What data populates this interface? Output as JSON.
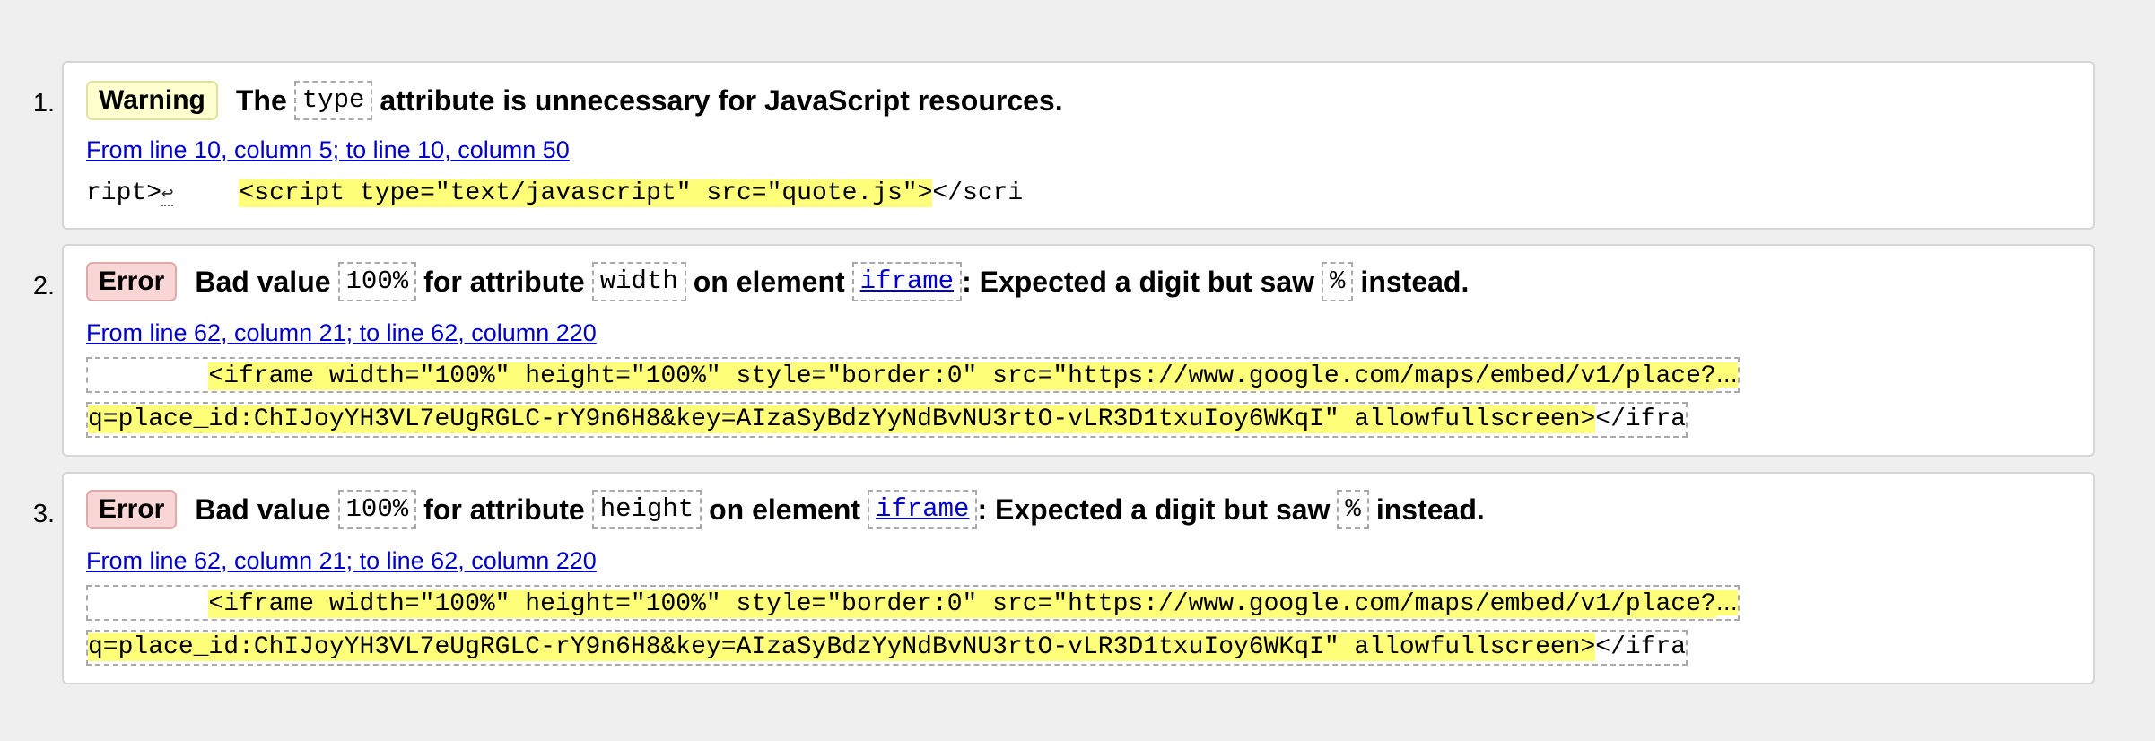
{
  "messages": [
    {
      "number": "1.",
      "type": "Warning",
      "parts": {
        "p1": "The",
        "code1": "type",
        "p2": "attribute is unnecessary for JavaScript resources."
      },
      "location": "From line 10, column 5; to line 10, column 50",
      "extract": {
        "pre": "ript>",
        "linebreak": "↩",
        "highlight": "<script type=\"text/javascript\" src=\"quote.js\">",
        "post": "</scri"
      }
    },
    {
      "number": "2.",
      "type": "Error",
      "parts": {
        "p1": "Bad value",
        "code1": "100%",
        "p2": "for attribute",
        "code2": "width",
        "p3": "on element",
        "code3": "iframe",
        "p4": ": Expected a digit but saw",
        "code4": "%",
        "p5": "instead."
      },
      "location": "From line 62, column 21; to line 62, column 220",
      "extract": {
        "line1_pre": "        ",
        "line1_highlight": "<iframe width=\"100%\" height=\"100%\" style=\"border:0\" src=\"https://www.google.com/maps/embed/v1/place?",
        "line1_ellipsis": "…",
        "line2_highlight": "q=place_id:ChIJoyYH3VL7eUgRGLC-rY9n6H8&key=AIzaSyBdzYyNdBvNU3rtO-vLR3D1txuIoy6WKqI\" allowfullscreen>",
        "line2_post": "</ifra"
      }
    },
    {
      "number": "3.",
      "type": "Error",
      "parts": {
        "p1": "Bad value",
        "code1": "100%",
        "p2": "for attribute",
        "code2": "height",
        "p3": "on element",
        "code3": "iframe",
        "p4": ": Expected a digit but saw",
        "code4": "%",
        "p5": "instead."
      },
      "location": "From line 62, column 21; to line 62, column 220",
      "extract": {
        "line1_pre": "        ",
        "line1_highlight": "<iframe width=\"100%\" height=\"100%\" style=\"border:0\" src=\"https://www.google.com/maps/embed/v1/place?",
        "line1_ellipsis": "…",
        "line2_highlight": "q=place_id:ChIJoyYH3VL7eUgRGLC-rY9n6H8&key=AIzaSyBdzYyNdBvNU3rtO-vLR3D1txuIoy6WKqI\" allowfullscreen>",
        "line2_post": "</ifra"
      }
    }
  ]
}
